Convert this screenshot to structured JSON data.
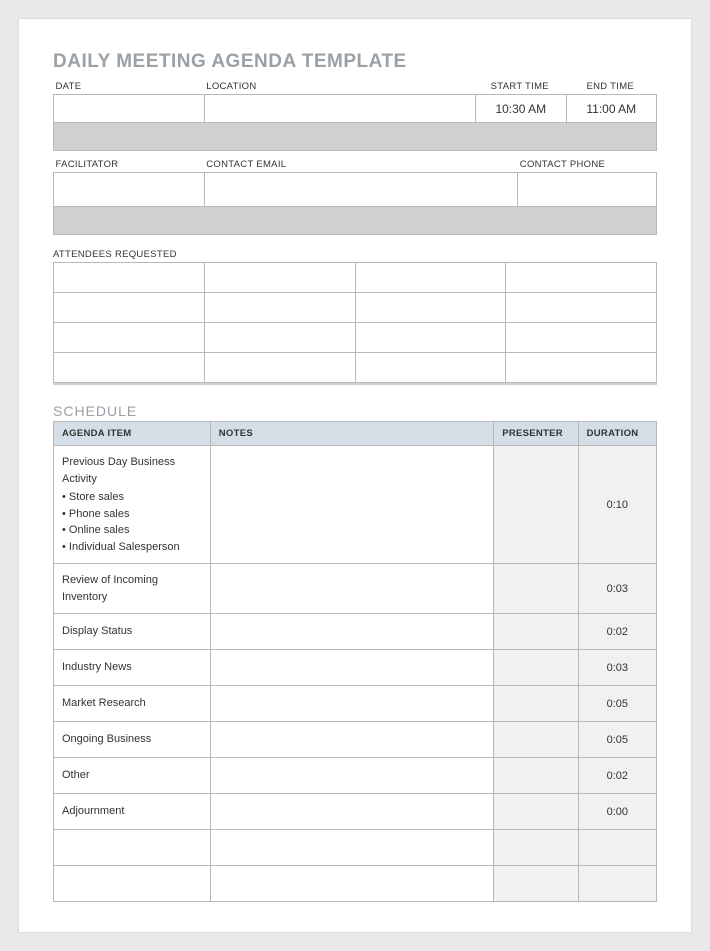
{
  "title": "DAILY MEETING AGENDA TEMPLATE",
  "info1": {
    "headers": {
      "date": "DATE",
      "location": "LOCATION",
      "start": "START TIME",
      "end": "END TIME"
    },
    "values": {
      "date": "",
      "location": "",
      "start": "10:30 AM",
      "end": "11:00 AM"
    }
  },
  "info2": {
    "headers": {
      "facilitator": "FACILITATOR",
      "email": "CONTACT EMAIL",
      "phone": "CONTACT PHONE"
    },
    "values": {
      "facilitator": "",
      "email": "",
      "phone": ""
    }
  },
  "attendees_label": "ATTENDEES REQUESTED",
  "schedule_heading": "SCHEDULE",
  "schedule_headers": {
    "item": "AGENDA ITEM",
    "notes": "NOTES",
    "presenter": "PRESENTER",
    "duration": "DURATION"
  },
  "schedule": [
    {
      "item": "Previous Day Business Activity",
      "bullets": [
        "Store sales",
        "Phone sales",
        "Online sales",
        "Individual Salesperson"
      ],
      "notes": "",
      "presenter": "",
      "duration": "0:10"
    },
    {
      "item": "Review of Incoming Inventory",
      "notes": "",
      "presenter": "",
      "duration": "0:03"
    },
    {
      "item": "Display Status",
      "notes": "",
      "presenter": "",
      "duration": "0:02"
    },
    {
      "item": "Industry News",
      "notes": "",
      "presenter": "",
      "duration": "0:03"
    },
    {
      "item": "Market Research",
      "notes": "",
      "presenter": "",
      "duration": "0:05"
    },
    {
      "item": "Ongoing Business",
      "notes": "",
      "presenter": "",
      "duration": "0:05"
    },
    {
      "item": "Other",
      "notes": "",
      "presenter": "",
      "duration": "0:02"
    },
    {
      "item": "Adjournment",
      "notes": "",
      "presenter": "",
      "duration": "0:00"
    },
    {
      "item": "",
      "notes": "",
      "presenter": "",
      "duration": ""
    },
    {
      "item": "",
      "notes": "",
      "presenter": "",
      "duration": ""
    }
  ]
}
